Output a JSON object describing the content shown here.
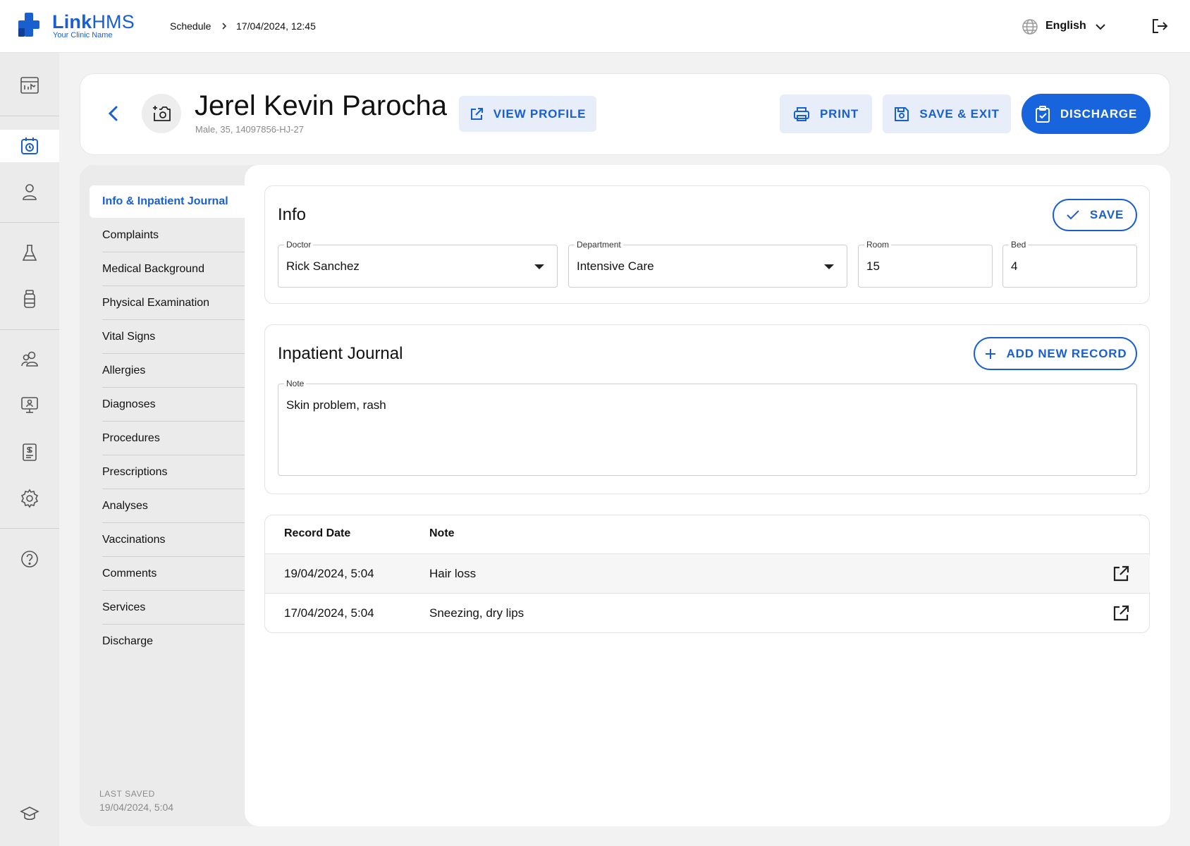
{
  "app": {
    "name_bold": "Link",
    "name_rest": "HMS",
    "clinic": "Your Clinic Name",
    "accent": "#1a5fd0"
  },
  "breadcrumb": {
    "section": "Schedule",
    "datetime": "17/04/2024, 12:45"
  },
  "header": {
    "language": "English"
  },
  "rail_icons": [
    "dashboard-icon",
    "schedule-icon",
    "patient-icon",
    "lab-icon",
    "pharmacy-icon",
    "staff-icon",
    "monitor-icon",
    "billing-icon",
    "settings-icon",
    "help-icon",
    "education-icon"
  ],
  "patient": {
    "name": "Jerel Kevin Parocha",
    "meta": "Male, 35, 14097856-HJ-27"
  },
  "actions": {
    "view_profile": "VIEW PROFILE",
    "print": "PRINT",
    "save_exit": "SAVE & EXIT",
    "discharge": "DISCHARGE"
  },
  "nav": {
    "items": [
      "Info & Inpatient Journal",
      "Complaints",
      "Medical Background",
      "Physical Examination",
      "Vital Signs",
      "Allergies",
      "Diagnoses",
      "Procedures",
      "Prescriptions",
      "Analyses",
      "Vaccinations",
      "Comments",
      "Services",
      "Discharge"
    ],
    "active": "Info & Inpatient Journal",
    "last_saved_label": "LAST SAVED",
    "last_saved_value": "19/04/2024, 5:04"
  },
  "info": {
    "title": "Info",
    "save": "SAVE",
    "doctor": {
      "label": "Doctor",
      "value": "Rick Sanchez"
    },
    "department": {
      "label": "Department",
      "value": "Intensive Care"
    },
    "room": {
      "label": "Room",
      "value": "15"
    },
    "bed": {
      "label": "Bed",
      "value": "4"
    }
  },
  "journal": {
    "title": "Inpatient Journal",
    "add_record": "ADD NEW RECORD",
    "note_label": "Note",
    "note_value": "Skin problem, rash"
  },
  "records": {
    "columns": [
      "Record Date",
      "Note"
    ],
    "rows": [
      {
        "date": "19/04/2024, 5:04",
        "note": "Hair loss"
      },
      {
        "date": "17/04/2024, 5:04",
        "note": "Sneezing, dry lips"
      }
    ]
  }
}
